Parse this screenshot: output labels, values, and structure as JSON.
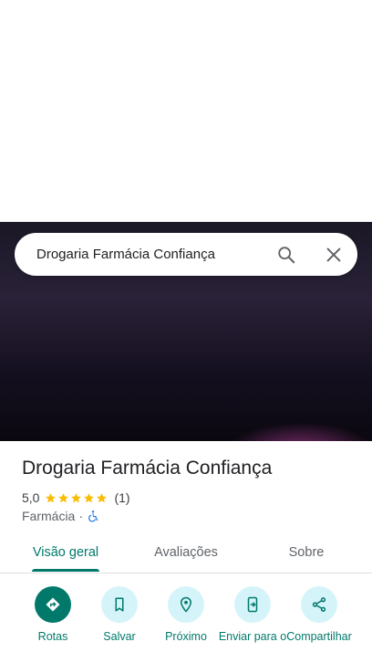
{
  "search": {
    "query": "Drogaria Farmácia Confiança"
  },
  "place": {
    "title": "Drogaria Farmácia Confiança",
    "rating": "5,0",
    "stars": 5,
    "review_count": "(1)",
    "category": "Farmácia",
    "separator": "·"
  },
  "tabs": [
    {
      "label": "Visão geral",
      "active": true
    },
    {
      "label": "Avaliações",
      "active": false
    },
    {
      "label": "Sobre",
      "active": false
    }
  ],
  "actions": [
    {
      "label": "Rotas",
      "icon": "directions-icon"
    },
    {
      "label": "Salvar",
      "icon": "bookmark-icon"
    },
    {
      "label": "Próximo",
      "icon": "nearby-icon"
    },
    {
      "label": "Enviar para o",
      "icon": "send-to-phone-icon"
    },
    {
      "label": "Compartilhar",
      "icon": "share-icon"
    }
  ],
  "colors": {
    "accent": "#00796b",
    "star": "#fbbc04",
    "action_bg": "#d5f4fa",
    "accessibility": "#1a73e8"
  }
}
